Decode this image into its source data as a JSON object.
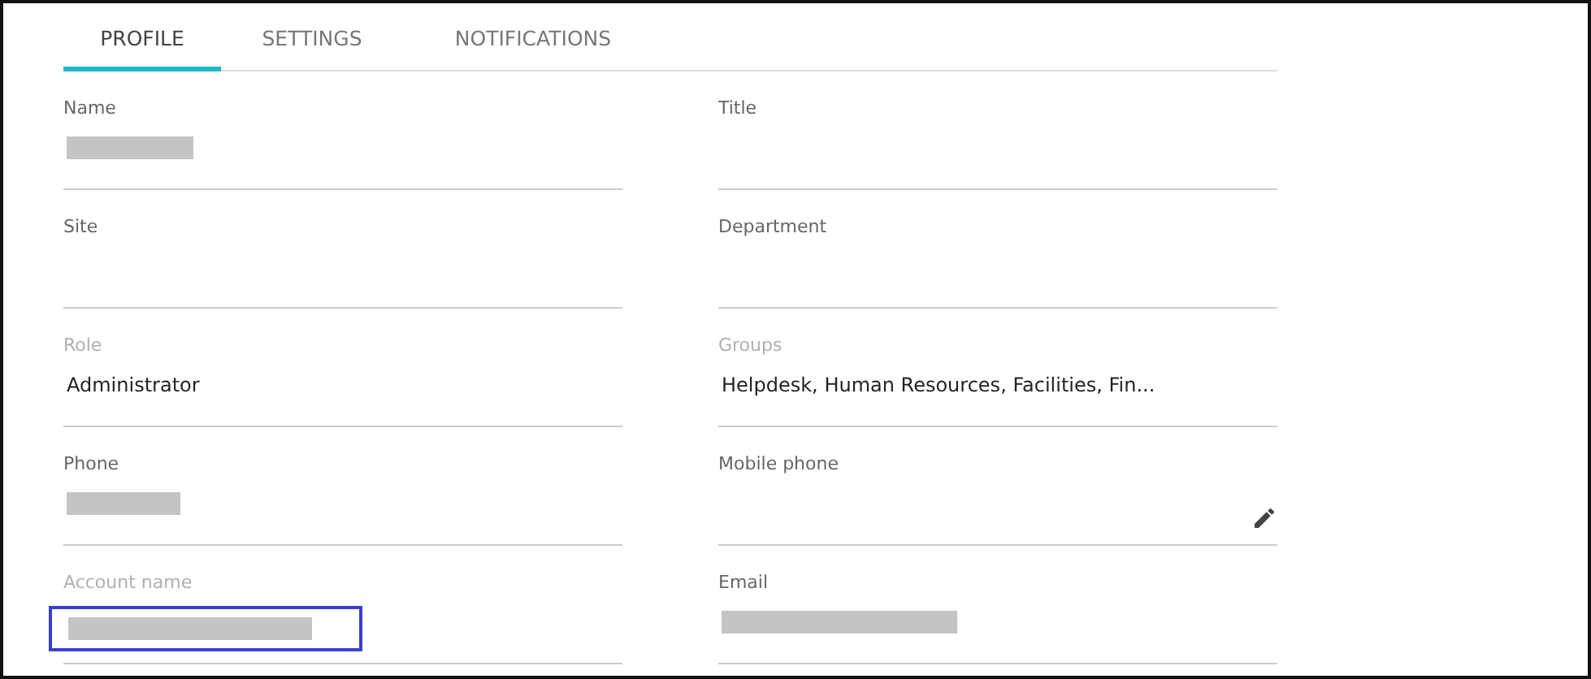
{
  "tabs": [
    {
      "label": "PROFILE",
      "selected": true
    },
    {
      "label": "SETTINGS",
      "selected": false
    },
    {
      "label": "NOTIFICATIONS",
      "selected": false
    }
  ],
  "fields": [
    {
      "label": "Name",
      "disabled": false,
      "redacted": true
    },
    {
      "label": "Title",
      "disabled": false
    },
    {
      "label": "Site",
      "disabled": false
    },
    {
      "label": "Department",
      "disabled": false
    },
    {
      "label": "Role",
      "disabled": true,
      "value": "Administrator"
    },
    {
      "label": "Groups",
      "disabled": true,
      "value": "Helpdesk, Human Resources, Facilities, Fin..."
    },
    {
      "label": "Phone",
      "disabled": false,
      "redacted": true
    },
    {
      "label": "Mobile phone",
      "disabled": false,
      "editable": true
    },
    {
      "label": "Account name",
      "disabled": true,
      "redacted": true,
      "highlighted": true
    },
    {
      "label": "Email",
      "disabled": false,
      "redacted": true
    }
  ]
}
